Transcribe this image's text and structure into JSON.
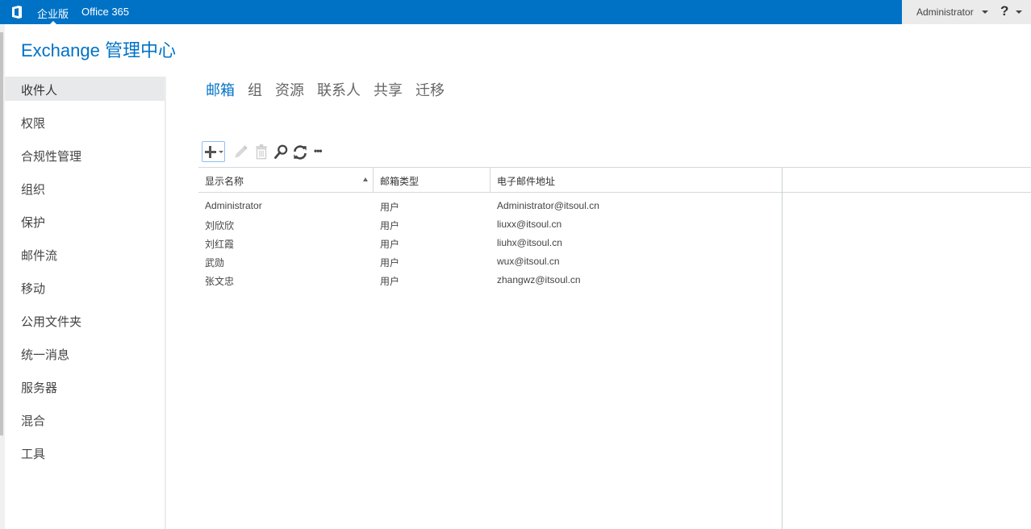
{
  "topbar": {
    "logo_icon": "office-logo-icon",
    "brand": "企业版",
    "product": "Office 365",
    "user": "Administrator",
    "help": "?"
  },
  "app_title": "Exchange 管理中心",
  "sidebar": {
    "items": [
      {
        "label": "收件人",
        "active": true
      },
      {
        "label": "权限"
      },
      {
        "label": "合规性管理"
      },
      {
        "label": "组织"
      },
      {
        "label": "保护"
      },
      {
        "label": "邮件流"
      },
      {
        "label": "移动"
      },
      {
        "label": "公用文件夹"
      },
      {
        "label": "统一消息"
      },
      {
        "label": "服务器"
      },
      {
        "label": "混合"
      },
      {
        "label": "工具"
      }
    ]
  },
  "tabs": [
    {
      "label": "邮箱",
      "active": true
    },
    {
      "label": "组"
    },
    {
      "label": "资源"
    },
    {
      "label": "联系人"
    },
    {
      "label": "共享"
    },
    {
      "label": "迁移"
    }
  ],
  "toolbar": {
    "buttons": [
      "add",
      "edit",
      "delete",
      "search",
      "refresh",
      "more"
    ],
    "more_label": "•••"
  },
  "grid": {
    "columns": [
      "显示名称",
      "邮箱类型",
      "电子邮件地址"
    ],
    "sort_column": "显示名称",
    "sort_direction": "ascending",
    "rows": [
      [
        "Administrator",
        "用户",
        "Administrator@itsoul.cn"
      ],
      [
        "刘欣欣",
        "用户",
        "liuxx@itsoul.cn"
      ],
      [
        "刘红霞",
        "用户",
        "liuhx@itsoul.cn"
      ],
      [
        "武勋",
        "用户",
        "wux@itsoul.cn"
      ],
      [
        "张文忠",
        "用户",
        "zhangwz@itsoul.cn"
      ]
    ]
  },
  "colors": {
    "brand_blue": "#0072c6",
    "topbar_right_bg": "#ebebeb",
    "nav_active_bg": "#e8e9ea"
  }
}
